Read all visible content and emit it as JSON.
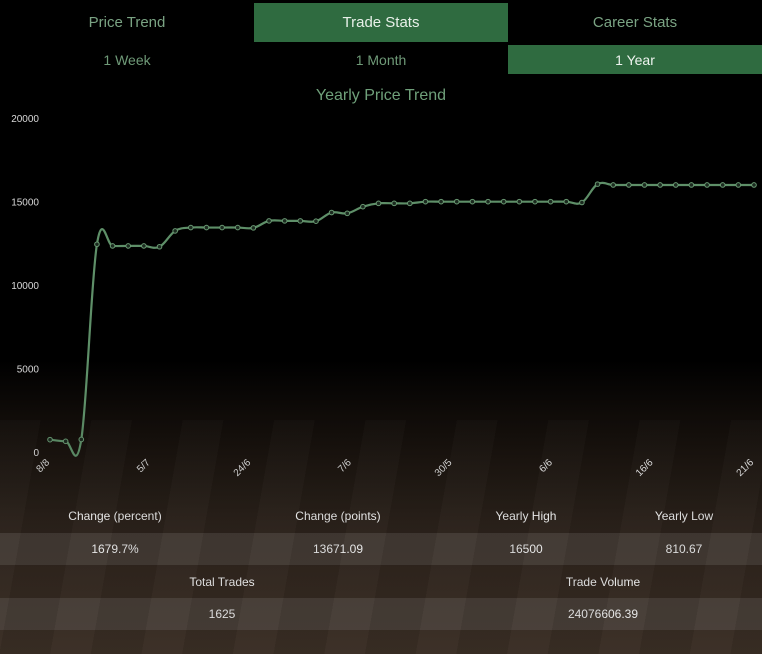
{
  "tabs": [
    {
      "label": "Price Trend",
      "active": false
    },
    {
      "label": "Trade Stats",
      "active": true
    },
    {
      "label": "Career Stats",
      "active": false
    }
  ],
  "periods": [
    {
      "label": "1 Week",
      "active": false
    },
    {
      "label": "1 Month",
      "active": false
    },
    {
      "label": "1 Year",
      "active": true
    }
  ],
  "colors": {
    "accent": "#2f6b40",
    "line": "#5e8f68",
    "tab_text": "#7aa383"
  },
  "chart_data": {
    "type": "line",
    "title": "Yearly Price Trend",
    "ylim": [
      0,
      20000
    ],
    "yticks": [
      0,
      5000,
      10000,
      15000,
      20000
    ],
    "xtick_labels": [
      "8/8",
      "5/7",
      "24/6",
      "7/6",
      "30/5",
      "6/6",
      "16/6",
      "21/6"
    ],
    "values": [
      800,
      700,
      810,
      12500,
      12400,
      12400,
      12400,
      12350,
      13300,
      13500,
      13500,
      13500,
      13500,
      13480,
      13900,
      13900,
      13900,
      13880,
      14400,
      14350,
      14750,
      14950,
      14950,
      14950,
      15050,
      15050,
      15050,
      15050,
      15050,
      15050,
      15050,
      15050,
      15050,
      15050,
      15000,
      16100,
      16050,
      16050,
      16050,
      16050,
      16050,
      16050,
      16050,
      16050,
      16050,
      16050
    ],
    "grid": false
  },
  "stats": {
    "row1": {
      "headers": [
        "Change (percent)",
        "Change (points)",
        "Yearly High",
        "Yearly Low"
      ],
      "values": [
        "1679.7%",
        "13671.09",
        "16500",
        "810.67"
      ]
    },
    "row2": {
      "headers": [
        "Total Trades",
        "Trade Volume"
      ],
      "values": [
        "1625",
        "24076606.39"
      ]
    }
  }
}
